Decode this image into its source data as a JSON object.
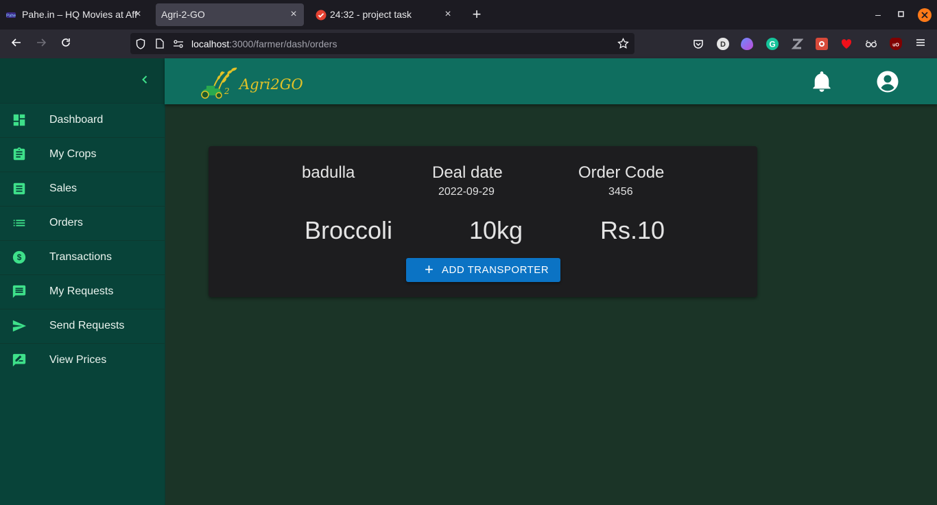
{
  "browser": {
    "tabs": [
      {
        "title": "Pahe.in – HQ Movies at Affor",
        "favicon": "pahe-icon",
        "active": false
      },
      {
        "title": "Agri-2-GO",
        "favicon": "",
        "active": true
      },
      {
        "title": "24:32 - project task",
        "favicon": "todo-check-icon",
        "active": false
      }
    ],
    "url": {
      "host": "localhost",
      "path": ":3000/farmer/dash/orders"
    },
    "extensions": [
      "pocket-icon",
      "d-extension-icon",
      "purple-extension-icon",
      "grammarly-icon",
      "z-extension-icon",
      "red-extension-icon",
      "heart-extension-icon",
      "glasses-extension-icon",
      "ublock-icon"
    ]
  },
  "app": {
    "logo_text": "Agri2GO",
    "sidebar": {
      "items": [
        {
          "label": "Dashboard",
          "icon": "dashboard-icon"
        },
        {
          "label": "My Crops",
          "icon": "assignment-icon"
        },
        {
          "label": "Sales",
          "icon": "receipt-icon"
        },
        {
          "label": "Orders",
          "icon": "list-icon"
        },
        {
          "label": "Transactions",
          "icon": "dollar-icon"
        },
        {
          "label": "My Requests",
          "icon": "message-icon"
        },
        {
          "label": "Send Requests",
          "icon": "send-icon"
        },
        {
          "label": "View Prices",
          "icon": "rate-review-icon"
        }
      ]
    },
    "colors": {
      "accent": "#3ee08a",
      "sidebar": "#084339",
      "appbar": "#0f6e5f",
      "button": "#0b73c4"
    }
  },
  "order": {
    "location": "badulla",
    "deal_date_label": "Deal date",
    "deal_date": "2022-09-29",
    "order_code_label": "Order Code",
    "order_code": "3456",
    "crop": "Broccoli",
    "quantity": "10kg",
    "price": "Rs.10",
    "button_label": "ADD TRANSPORTER"
  }
}
